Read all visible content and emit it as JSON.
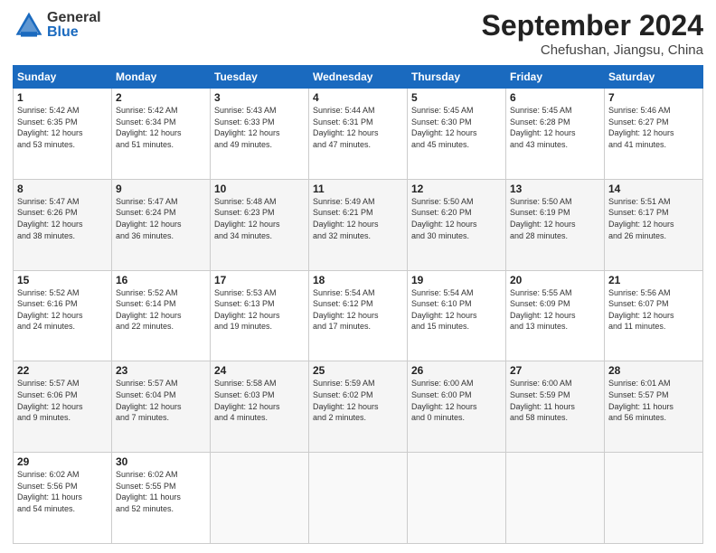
{
  "header": {
    "logo_general": "General",
    "logo_blue": "Blue",
    "month_title": "September 2024",
    "subtitle": "Chefushan, Jiangsu, China"
  },
  "days_of_week": [
    "Sunday",
    "Monday",
    "Tuesday",
    "Wednesday",
    "Thursday",
    "Friday",
    "Saturday"
  ],
  "weeks": [
    [
      {
        "day": "1",
        "info": "Sunrise: 5:42 AM\nSunset: 6:35 PM\nDaylight: 12 hours\nand 53 minutes."
      },
      {
        "day": "2",
        "info": "Sunrise: 5:42 AM\nSunset: 6:34 PM\nDaylight: 12 hours\nand 51 minutes."
      },
      {
        "day": "3",
        "info": "Sunrise: 5:43 AM\nSunset: 6:33 PM\nDaylight: 12 hours\nand 49 minutes."
      },
      {
        "day": "4",
        "info": "Sunrise: 5:44 AM\nSunset: 6:31 PM\nDaylight: 12 hours\nand 47 minutes."
      },
      {
        "day": "5",
        "info": "Sunrise: 5:45 AM\nSunset: 6:30 PM\nDaylight: 12 hours\nand 45 minutes."
      },
      {
        "day": "6",
        "info": "Sunrise: 5:45 AM\nSunset: 6:28 PM\nDaylight: 12 hours\nand 43 minutes."
      },
      {
        "day": "7",
        "info": "Sunrise: 5:46 AM\nSunset: 6:27 PM\nDaylight: 12 hours\nand 41 minutes."
      }
    ],
    [
      {
        "day": "8",
        "info": "Sunrise: 5:47 AM\nSunset: 6:26 PM\nDaylight: 12 hours\nand 38 minutes."
      },
      {
        "day": "9",
        "info": "Sunrise: 5:47 AM\nSunset: 6:24 PM\nDaylight: 12 hours\nand 36 minutes."
      },
      {
        "day": "10",
        "info": "Sunrise: 5:48 AM\nSunset: 6:23 PM\nDaylight: 12 hours\nand 34 minutes."
      },
      {
        "day": "11",
        "info": "Sunrise: 5:49 AM\nSunset: 6:21 PM\nDaylight: 12 hours\nand 32 minutes."
      },
      {
        "day": "12",
        "info": "Sunrise: 5:50 AM\nSunset: 6:20 PM\nDaylight: 12 hours\nand 30 minutes."
      },
      {
        "day": "13",
        "info": "Sunrise: 5:50 AM\nSunset: 6:19 PM\nDaylight: 12 hours\nand 28 minutes."
      },
      {
        "day": "14",
        "info": "Sunrise: 5:51 AM\nSunset: 6:17 PM\nDaylight: 12 hours\nand 26 minutes."
      }
    ],
    [
      {
        "day": "15",
        "info": "Sunrise: 5:52 AM\nSunset: 6:16 PM\nDaylight: 12 hours\nand 24 minutes."
      },
      {
        "day": "16",
        "info": "Sunrise: 5:52 AM\nSunset: 6:14 PM\nDaylight: 12 hours\nand 22 minutes."
      },
      {
        "day": "17",
        "info": "Sunrise: 5:53 AM\nSunset: 6:13 PM\nDaylight: 12 hours\nand 19 minutes."
      },
      {
        "day": "18",
        "info": "Sunrise: 5:54 AM\nSunset: 6:12 PM\nDaylight: 12 hours\nand 17 minutes."
      },
      {
        "day": "19",
        "info": "Sunrise: 5:54 AM\nSunset: 6:10 PM\nDaylight: 12 hours\nand 15 minutes."
      },
      {
        "day": "20",
        "info": "Sunrise: 5:55 AM\nSunset: 6:09 PM\nDaylight: 12 hours\nand 13 minutes."
      },
      {
        "day": "21",
        "info": "Sunrise: 5:56 AM\nSunset: 6:07 PM\nDaylight: 12 hours\nand 11 minutes."
      }
    ],
    [
      {
        "day": "22",
        "info": "Sunrise: 5:57 AM\nSunset: 6:06 PM\nDaylight: 12 hours\nand 9 minutes."
      },
      {
        "day": "23",
        "info": "Sunrise: 5:57 AM\nSunset: 6:04 PM\nDaylight: 12 hours\nand 7 minutes."
      },
      {
        "day": "24",
        "info": "Sunrise: 5:58 AM\nSunset: 6:03 PM\nDaylight: 12 hours\nand 4 minutes."
      },
      {
        "day": "25",
        "info": "Sunrise: 5:59 AM\nSunset: 6:02 PM\nDaylight: 12 hours\nand 2 minutes."
      },
      {
        "day": "26",
        "info": "Sunrise: 6:00 AM\nSunset: 6:00 PM\nDaylight: 12 hours\nand 0 minutes."
      },
      {
        "day": "27",
        "info": "Sunrise: 6:00 AM\nSunset: 5:59 PM\nDaylight: 11 hours\nand 58 minutes."
      },
      {
        "day": "28",
        "info": "Sunrise: 6:01 AM\nSunset: 5:57 PM\nDaylight: 11 hours\nand 56 minutes."
      }
    ],
    [
      {
        "day": "29",
        "info": "Sunrise: 6:02 AM\nSunset: 5:56 PM\nDaylight: 11 hours\nand 54 minutes."
      },
      {
        "day": "30",
        "info": "Sunrise: 6:02 AM\nSunset: 5:55 PM\nDaylight: 11 hours\nand 52 minutes."
      },
      {
        "day": "",
        "info": ""
      },
      {
        "day": "",
        "info": ""
      },
      {
        "day": "",
        "info": ""
      },
      {
        "day": "",
        "info": ""
      },
      {
        "day": "",
        "info": ""
      }
    ]
  ]
}
